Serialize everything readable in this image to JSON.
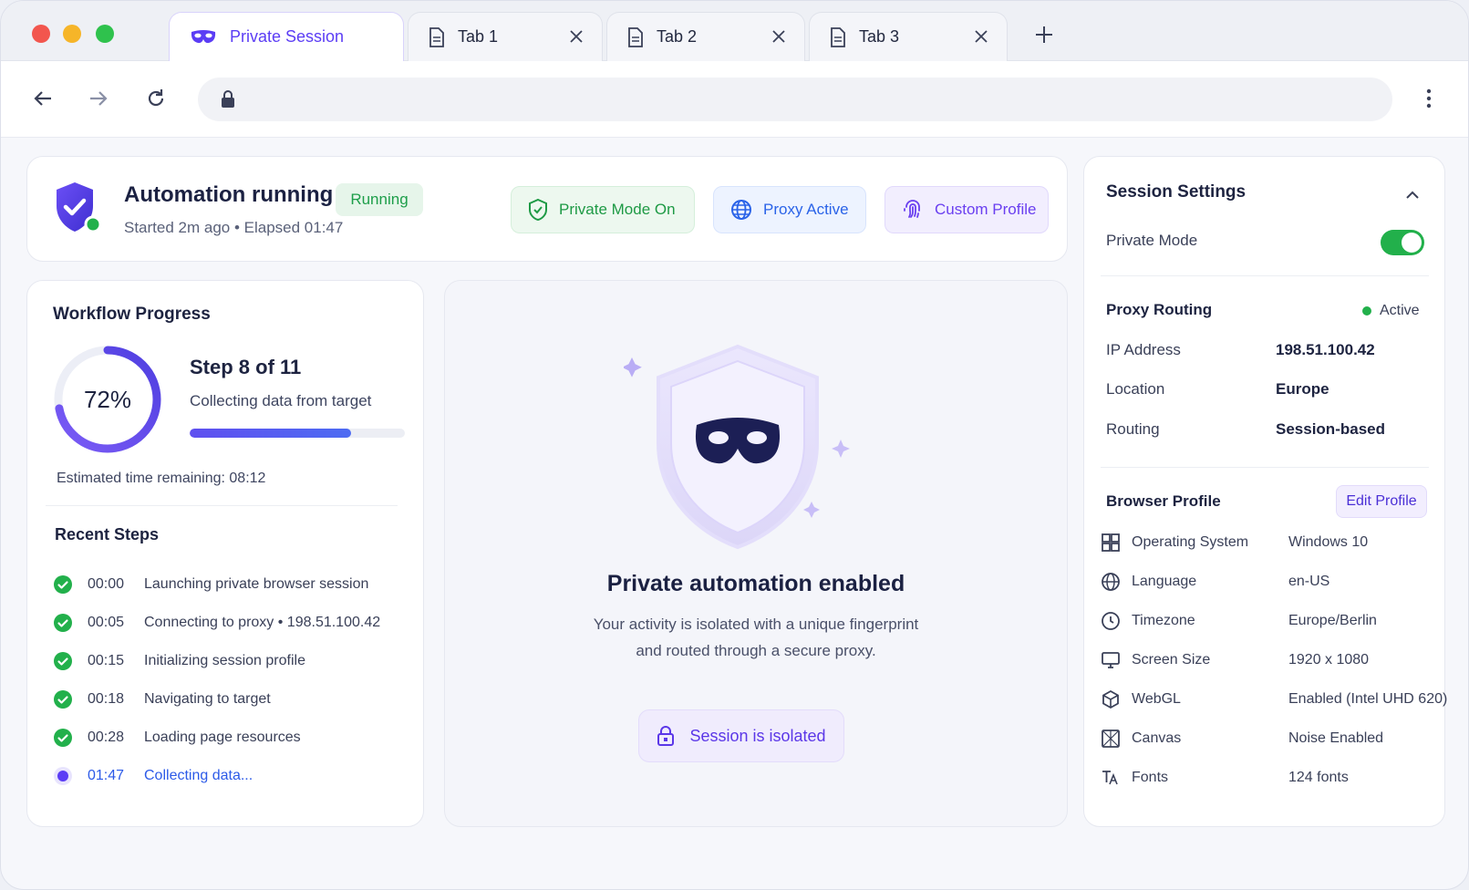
{
  "tabs": [
    {
      "label": "Private Session",
      "active": true,
      "icon": "mask-icon"
    },
    {
      "label": "Tab 1",
      "active": false,
      "icon": "document-icon"
    },
    {
      "label": "Tab 2",
      "active": false,
      "icon": "document-icon"
    },
    {
      "label": "Tab 3",
      "active": false,
      "icon": "document-icon"
    }
  ],
  "address_bar": {
    "value": "",
    "placeholder": ""
  },
  "status": {
    "title": "Automation running",
    "badge": "Running",
    "subtitle": "Started 2m ago  •  Elapsed 01:47",
    "chips": {
      "private_mode": "Private Mode On",
      "proxy": "Proxy Active",
      "profile": "Custom Profile"
    }
  },
  "workflow": {
    "title": "Workflow Progress",
    "percent_label": "72%",
    "percent": 0.72,
    "step_title": "Step 8 of 11",
    "step_desc": "Collecting data from target",
    "step_progress": 0.75,
    "eta": "Estimated time remaining: 08:12",
    "recent_title": "Recent Steps",
    "steps": [
      {
        "time": "00:00",
        "text": "Launching private browser session",
        "state": "done"
      },
      {
        "time": "00:05",
        "text": "Connecting to proxy  •  198.51.100.42",
        "state": "done"
      },
      {
        "time": "00:15",
        "text": "Initializing session profile",
        "state": "done"
      },
      {
        "time": "00:18",
        "text": "Navigating to target",
        "state": "done"
      },
      {
        "time": "00:28",
        "text": "Loading page resources",
        "state": "done"
      },
      {
        "time": "01:47",
        "text": "Collecting data...",
        "state": "current"
      }
    ]
  },
  "center": {
    "title": "Private automation enabled",
    "desc_line1": "Your activity is isolated with a unique fingerprint",
    "desc_line2": "and routed through a secure proxy.",
    "isolated": "Session is isolated"
  },
  "settings": {
    "title": "Session Settings",
    "private_mode_label": "Private Mode",
    "private_mode_on": true,
    "proxy": {
      "title": "Proxy Routing",
      "status": "Active",
      "rows": [
        {
          "label": "IP Address",
          "value": "198.51.100.42"
        },
        {
          "label": "Location",
          "value": "Europe"
        },
        {
          "label": "Routing",
          "value": "Session-based"
        }
      ]
    },
    "profile": {
      "title": "Browser Profile",
      "edit": "Edit Profile",
      "rows": [
        {
          "label": "Operating System",
          "value": "Windows 10",
          "icon": "windows-icon"
        },
        {
          "label": "Language",
          "value": "en-US",
          "icon": "globe-icon"
        },
        {
          "label": "Timezone",
          "value": "Europe/Berlin",
          "icon": "clock-icon"
        },
        {
          "label": "Screen Size",
          "value": "1920 x 1080",
          "icon": "monitor-icon"
        },
        {
          "label": "WebGL",
          "value": "Enabled (Intel UHD 620)",
          "icon": "cube-icon"
        },
        {
          "label": "Canvas",
          "value": "Noise Enabled",
          "icon": "canvas-icon"
        },
        {
          "label": "Fonts",
          "value": "124 fonts",
          "icon": "font-icon"
        }
      ]
    }
  },
  "colors": {
    "accent": "#5b3df5",
    "success": "#22b04b",
    "proxy_blue": "#2a63e8"
  }
}
